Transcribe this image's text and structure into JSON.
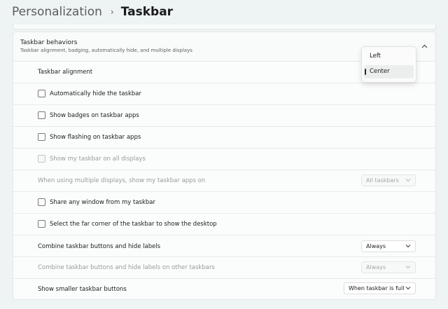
{
  "breadcrumb": {
    "parent": "Personalization",
    "separator": "›",
    "current": "Taskbar"
  },
  "section": {
    "title": "Taskbar behaviors",
    "subtitle": "Taskbar alignment, badging, automatically hide, and multiple displays",
    "collapse_icon": "chevron-up-icon"
  },
  "alignment": {
    "label": "Taskbar alignment",
    "options": [
      "Left",
      "Center"
    ],
    "selected": "Center"
  },
  "checkboxes": {
    "auto_hide": {
      "label": "Automatically hide the taskbar",
      "checked": false,
      "enabled": true
    },
    "badges": {
      "label": "Show badges on taskbar apps",
      "checked": false,
      "enabled": true
    },
    "flashing": {
      "label": "Show flashing on taskbar apps",
      "checked": false,
      "enabled": true
    },
    "all_displays": {
      "label": "Show my taskbar on all displays",
      "checked": false,
      "enabled": false
    },
    "share_window": {
      "label": "Share any window from my taskbar",
      "checked": false,
      "enabled": true
    },
    "far_corner": {
      "label": "Select the far corner of the taskbar to show the desktop",
      "checked": false,
      "enabled": true
    }
  },
  "multi_display": {
    "label": "When using multiple displays, show my taskbar apps on",
    "value": "All taskbars",
    "enabled": false
  },
  "combine": {
    "label": "Combine taskbar buttons and hide labels",
    "value": "Always",
    "enabled": true
  },
  "combine_other": {
    "label": "Combine taskbar buttons and hide labels on other taskbars",
    "value": "Always",
    "enabled": false
  },
  "smaller_buttons": {
    "label": "Show smaller taskbar buttons",
    "value": "When taskbar is full",
    "enabled": true
  },
  "colors": {
    "background": "#eef3f4",
    "panel": "#fbfcfc",
    "disabled_text": "#9a9a9a"
  }
}
